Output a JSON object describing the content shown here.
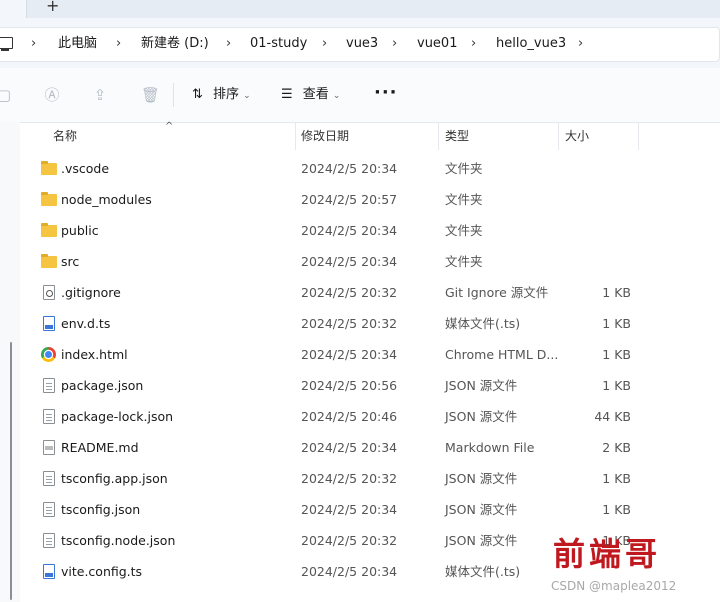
{
  "tabs": {
    "new_tab_symbol": "+"
  },
  "breadcrumb": [
    "此电脑",
    "新建卷 (D:)",
    "01-study",
    "vue3",
    "vue01",
    "hello_vue3"
  ],
  "toolbar": {
    "sort_label": "排序",
    "view_label": "查看",
    "more_label": "···"
  },
  "columns": {
    "name": "名称",
    "date": "修改日期",
    "type": "类型",
    "size": "大小"
  },
  "files": [
    {
      "icon": "folder-icon",
      "name": ".vscode",
      "date": "2024/2/5 20:34",
      "type": "文件夹",
      "size": ""
    },
    {
      "icon": "folder-icon",
      "name": "node_modules",
      "date": "2024/2/5 20:57",
      "type": "文件夹",
      "size": ""
    },
    {
      "icon": "folder-icon",
      "name": "public",
      "date": "2024/2/5 20:34",
      "type": "文件夹",
      "size": ""
    },
    {
      "icon": "folder-icon",
      "name": "src",
      "date": "2024/2/5 20:34",
      "type": "文件夹",
      "size": ""
    },
    {
      "icon": "gear-file-icon",
      "name": ".gitignore",
      "date": "2024/2/5 20:32",
      "type": "Git Ignore 源文件",
      "size": "1 KB"
    },
    {
      "icon": "media-file-icon",
      "name": "env.d.ts",
      "date": "2024/2/5 20:32",
      "type": "媒体文件(.ts)",
      "size": "1 KB"
    },
    {
      "icon": "chrome-icon",
      "name": "index.html",
      "date": "2024/2/5 20:34",
      "type": "Chrome HTML D...",
      "size": "1 KB"
    },
    {
      "icon": "json-file-icon",
      "name": "package.json",
      "date": "2024/2/5 20:56",
      "type": "JSON 源文件",
      "size": "1 KB"
    },
    {
      "icon": "json-file-icon",
      "name": "package-lock.json",
      "date": "2024/2/5 20:46",
      "type": "JSON 源文件",
      "size": "44 KB"
    },
    {
      "icon": "markdown-file-icon",
      "name": "README.md",
      "date": "2024/2/5 20:34",
      "type": "Markdown File",
      "size": "2 KB"
    },
    {
      "icon": "json-file-icon",
      "name": "tsconfig.app.json",
      "date": "2024/2/5 20:32",
      "type": "JSON 源文件",
      "size": "1 KB"
    },
    {
      "icon": "json-file-icon",
      "name": "tsconfig.json",
      "date": "2024/2/5 20:34",
      "type": "JSON 源文件",
      "size": "1 KB"
    },
    {
      "icon": "json-file-icon",
      "name": "tsconfig.node.json",
      "date": "2024/2/5 20:32",
      "type": "JSON 源文件",
      "size": "1 KB"
    },
    {
      "icon": "media-file-icon",
      "name": "vite.config.ts",
      "date": "2024/2/5 20:34",
      "type": "媒体文件(.ts)",
      "size": ""
    }
  ],
  "watermark": {
    "brand": "前端哥",
    "credit": "CSDN @maplea2012"
  },
  "colors": {
    "folder": "#f5c542",
    "watermark_red": "#c0181f",
    "media_blue": "#3a76d6"
  }
}
